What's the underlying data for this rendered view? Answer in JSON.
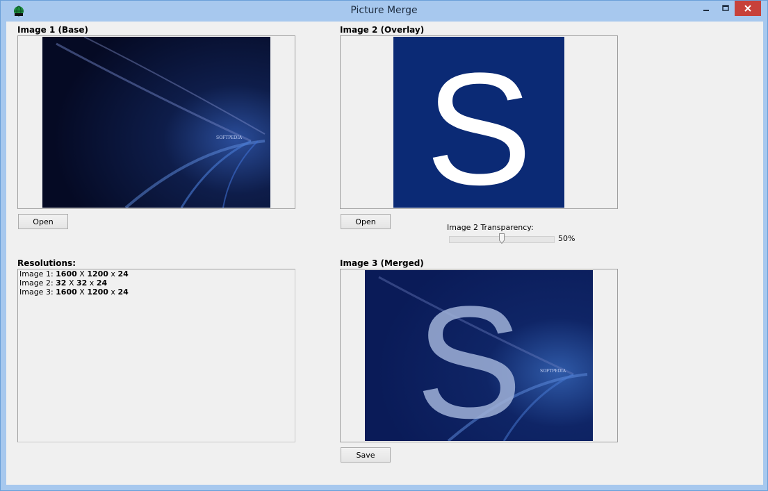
{
  "window": {
    "title": "Picture Merge",
    "app_icon": "globe-app-icon",
    "close_color": "#c7413a"
  },
  "image1": {
    "label": "Image 1 (Base)",
    "open_label": "Open",
    "watermark": "SOFTPEDIA"
  },
  "image2": {
    "label": "Image 2 (Overlay)",
    "open_label": "Open",
    "letter": "S"
  },
  "transparency": {
    "label": "Image 2 Transparency:",
    "value_text": "50%",
    "value": 0.5
  },
  "resolutions": {
    "label": "Resolutions:",
    "lines": [
      {
        "prefix": "Image 1: ",
        "w": "1600",
        "x1": " X ",
        "h": "1200",
        "x2": " x ",
        "d": "24"
      },
      {
        "prefix": "Image 2: ",
        "w": "32",
        "x1": " X ",
        "h": "32",
        "x2": " x ",
        "d": "24"
      },
      {
        "prefix": "Image 3: ",
        "w": "1600",
        "x1": " X ",
        "h": "1200",
        "x2": " x ",
        "d": "24"
      }
    ]
  },
  "image3": {
    "label": "Image 3 (Merged)",
    "save_label": "Save",
    "letter": "S",
    "watermark": "SOFTPEDIA"
  }
}
